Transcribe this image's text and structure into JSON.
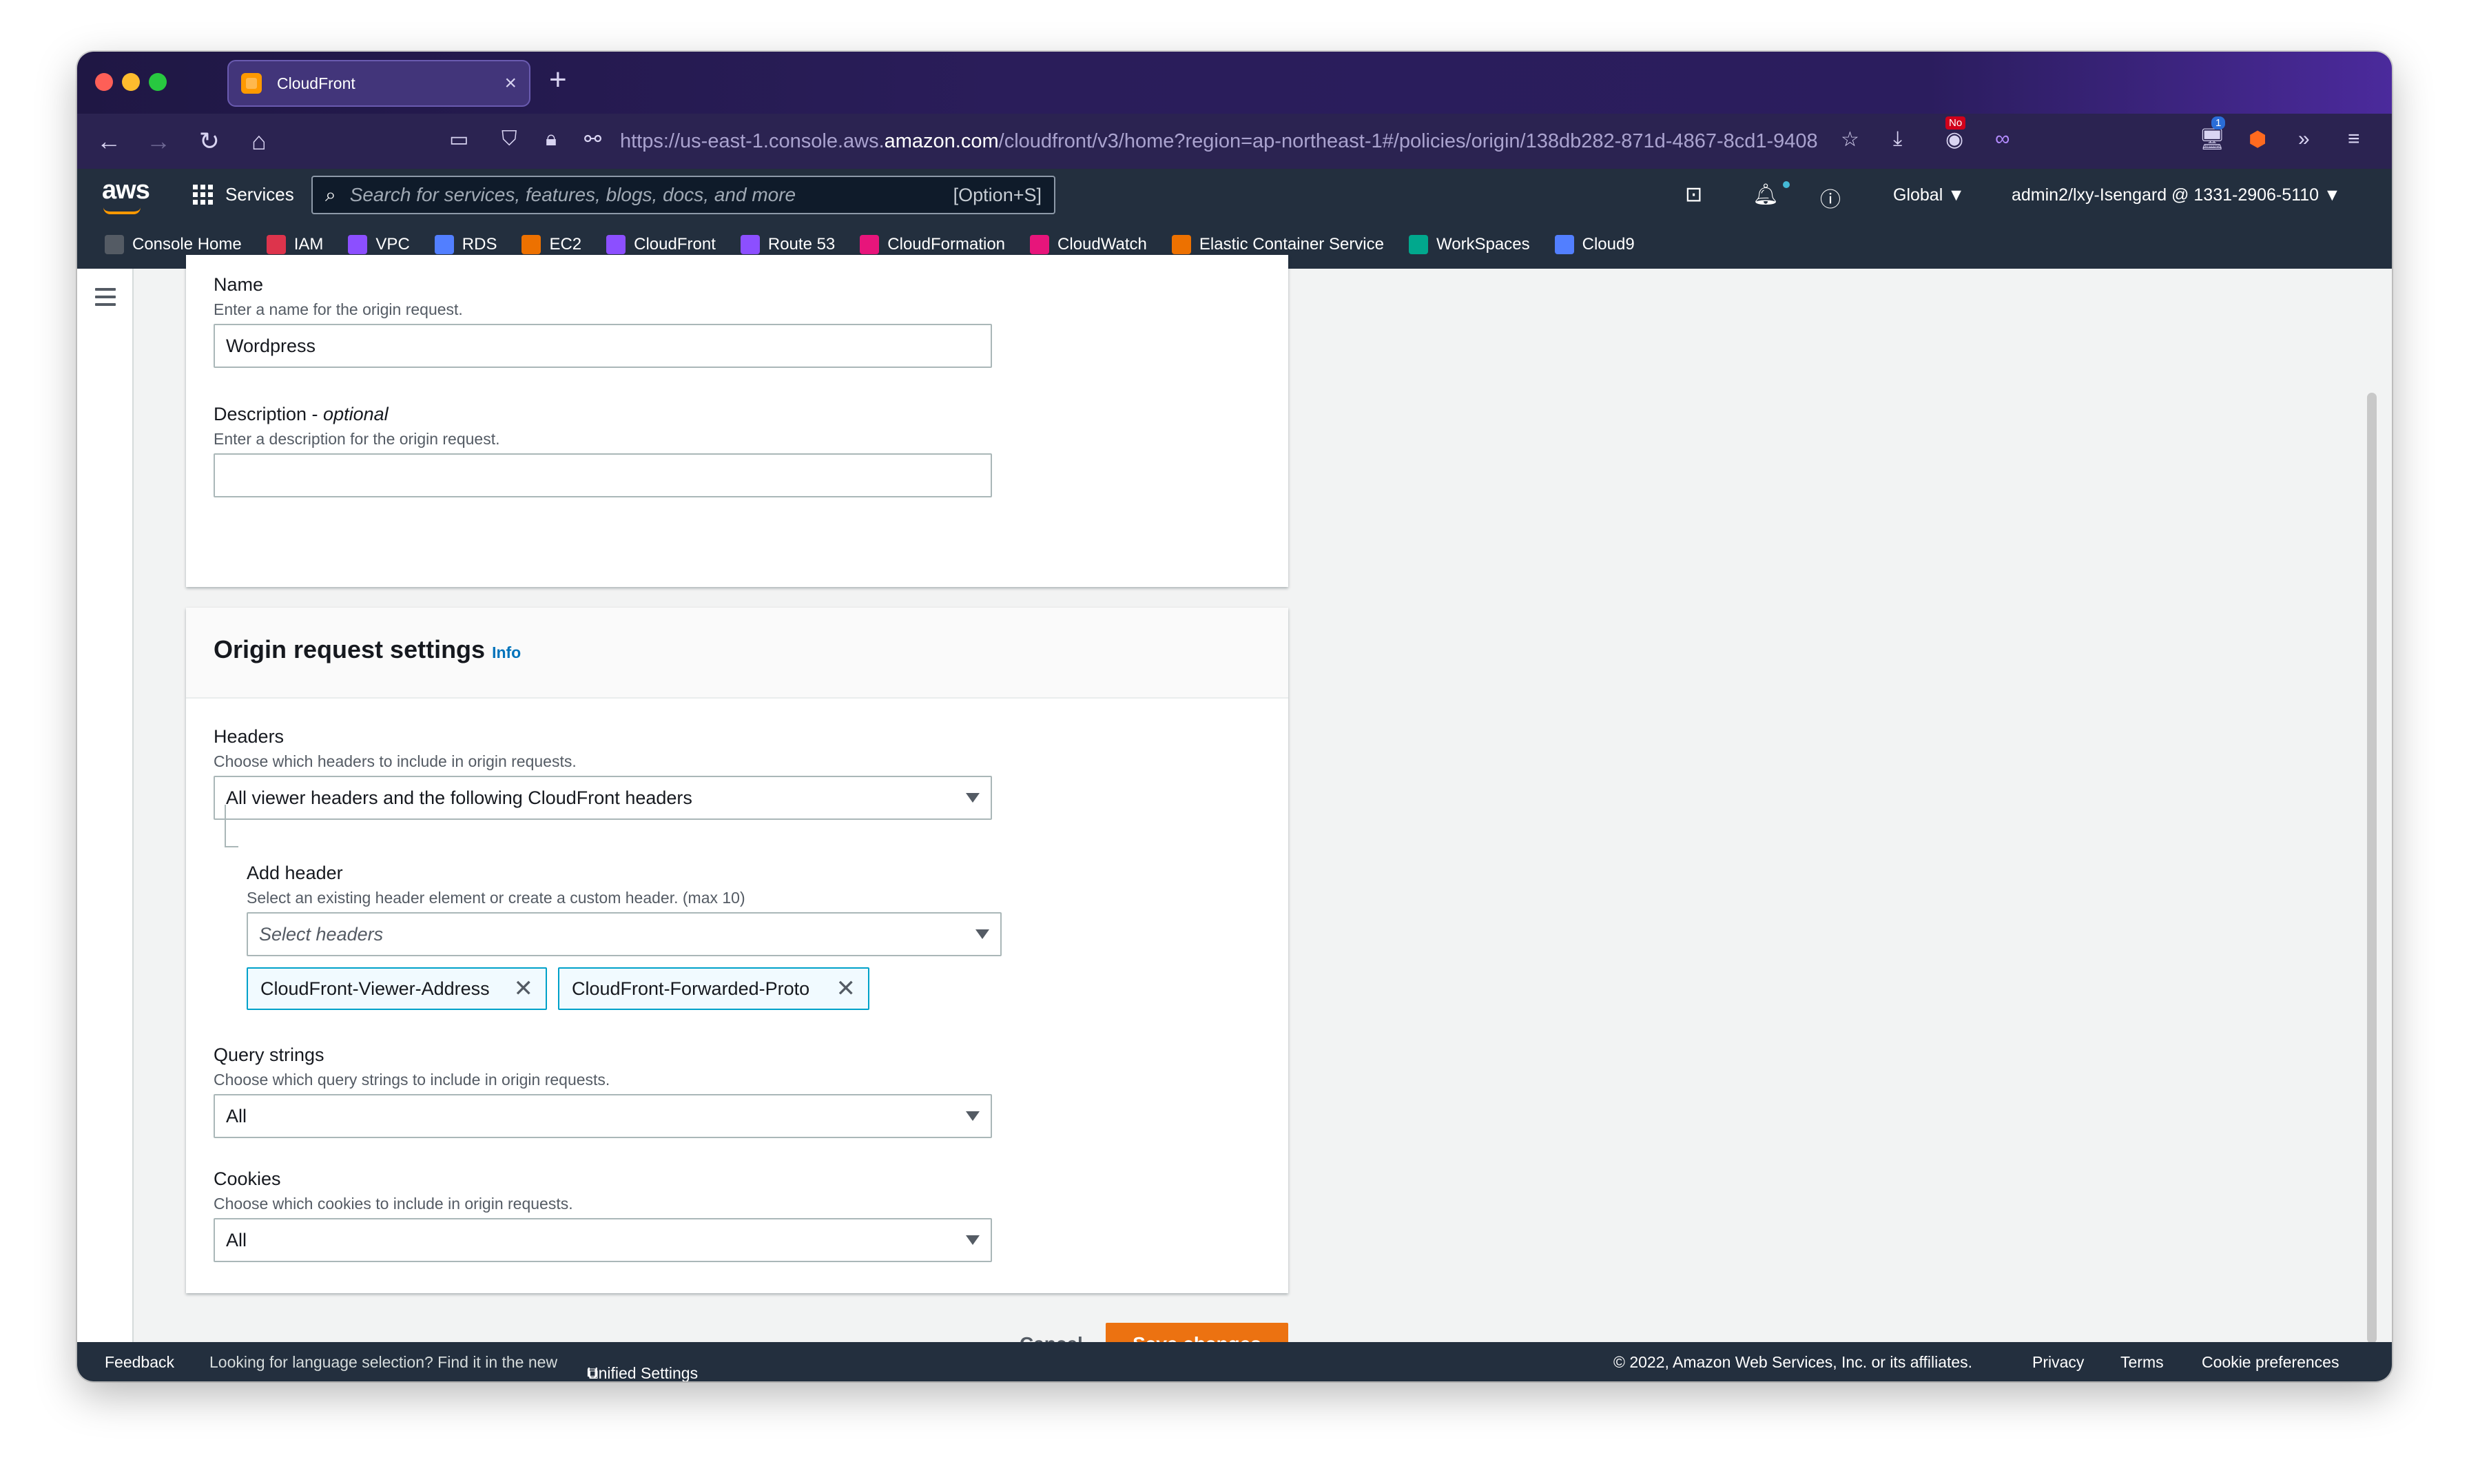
{
  "browser": {
    "tab_title": "CloudFront",
    "url_prefix": "https://us-east-1.console.aws.",
    "url_host": "amazon.com",
    "url_path": "/cloudfront/v3/home?region=ap-northeast-1#/policies/origin/138db282-871d-4867-8cd1-9408",
    "badge_no": "No",
    "badge_count": "1"
  },
  "aws_header": {
    "logo": "aws",
    "services_label": "Services",
    "search_placeholder": "Search for services, features, blogs, docs, and more",
    "search_shortcut": "[Option+S]",
    "region": "Global ▼",
    "account": "admin2/lxy-Isengard @ 1331-2906-5110 ▼"
  },
  "favorites": [
    {
      "label": "Console Home",
      "color": "#545b64"
    },
    {
      "label": "IAM",
      "color": "#dd344c"
    },
    {
      "label": "VPC",
      "color": "#8c4fff"
    },
    {
      "label": "RDS",
      "color": "#527fff"
    },
    {
      "label": "EC2",
      "color": "#ed7100"
    },
    {
      "label": "CloudFront",
      "color": "#8c4fff"
    },
    {
      "label": "Route 53",
      "color": "#8c4fff"
    },
    {
      "label": "CloudFormation",
      "color": "#e7157b"
    },
    {
      "label": "CloudWatch",
      "color": "#e7157b"
    },
    {
      "label": "Elastic Container Service",
      "color": "#ed7100"
    },
    {
      "label": "WorkSpaces",
      "color": "#01a88d"
    },
    {
      "label": "Cloud9",
      "color": "#527fff"
    }
  ],
  "details": {
    "name_label": "Name",
    "name_desc": "Enter a name for the origin request.",
    "name_value": "Wordpress",
    "description_label": "Description - ",
    "description_optional": "optional",
    "description_desc": "Enter a description for the origin request.",
    "description_value": ""
  },
  "settings": {
    "title": "Origin request settings",
    "info": "Info",
    "headers_label": "Headers",
    "headers_desc": "Choose which headers to include in origin requests.",
    "headers_value": "All viewer headers and the following CloudFront headers",
    "add_header_label": "Add header",
    "add_header_desc": "Select an existing header element or create a custom header. (max 10)",
    "add_header_placeholder": "Select headers",
    "tokens": [
      "CloudFront-Viewer-Address",
      "CloudFront-Forwarded-Proto"
    ],
    "query_label": "Query strings",
    "query_desc": "Choose which query strings to include in origin requests.",
    "query_value": "All",
    "cookies_label": "Cookies",
    "cookies_desc": "Choose which cookies to include in origin requests.",
    "cookies_value": "All"
  },
  "actions": {
    "cancel": "Cancel",
    "save": "Save changes"
  },
  "footer": {
    "feedback": "Feedback",
    "language_text": "Looking for language selection? Find it in the new",
    "unified_settings": "Unified Settings",
    "copyright": "© 2022, Amazon Web Services, Inc. or its affiliates.",
    "privacy": "Privacy",
    "terms": "Terms",
    "cookie_prefs": "Cookie preferences"
  }
}
